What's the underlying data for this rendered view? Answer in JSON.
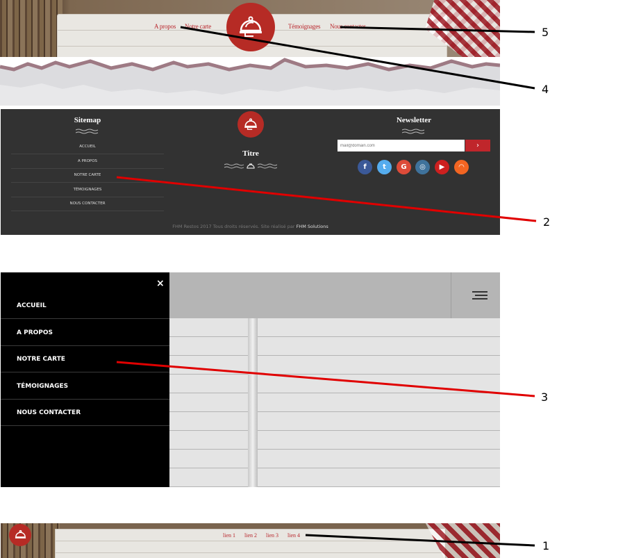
{
  "header": {
    "nav_left": [
      "A propos",
      "Notre carte"
    ],
    "nav_right": [
      "Témoignages",
      "Nous contacter"
    ],
    "logo_icon": "cloche-icon"
  },
  "footer": {
    "sitemap_title": "Sitemap",
    "sitemap_items": [
      "ACCUEIL",
      "A PROPOS",
      "NOTRE CARTE",
      "TÉMOIGNAGES",
      "NOUS CONTACTER"
    ],
    "center_title": "Titre",
    "newsletter_title": "Newsletter",
    "newsletter_placeholder": "mail@domain.com",
    "newsletter_button_icon": "chevron-right-icon",
    "social": [
      {
        "name": "facebook-icon",
        "glyph": "f",
        "color": "#3b5998"
      },
      {
        "name": "twitter-icon",
        "glyph": "t",
        "color": "#55acee"
      },
      {
        "name": "google-plus-icon",
        "glyph": "G",
        "color": "#dd4b39"
      },
      {
        "name": "instagram-icon",
        "glyph": "◎",
        "color": "#3f729b"
      },
      {
        "name": "youtube-icon",
        "glyph": "▶",
        "color": "#cd201f"
      },
      {
        "name": "rss-icon",
        "glyph": "◠",
        "color": "#f26522"
      }
    ],
    "copyright_text": "FHM Restos 2017 Tous droits réservés. Site réalisé par",
    "copyright_link": "FHM Solutions",
    "accent": "#c0262b"
  },
  "mobile_menu": {
    "close_glyph": "×",
    "items": [
      "ACCUEIL",
      "A PROPOS",
      "NOTRE CARTE",
      "TÉMOIGNAGES",
      "NOUS CONTACTER"
    ],
    "burger_icon": "hamburger-icon"
  },
  "small_header": {
    "links": [
      "lien 1",
      "lien 2",
      "lien 3",
      "lien 4"
    ]
  },
  "callouts": [
    "5",
    "4",
    "2",
    "3",
    "1"
  ]
}
